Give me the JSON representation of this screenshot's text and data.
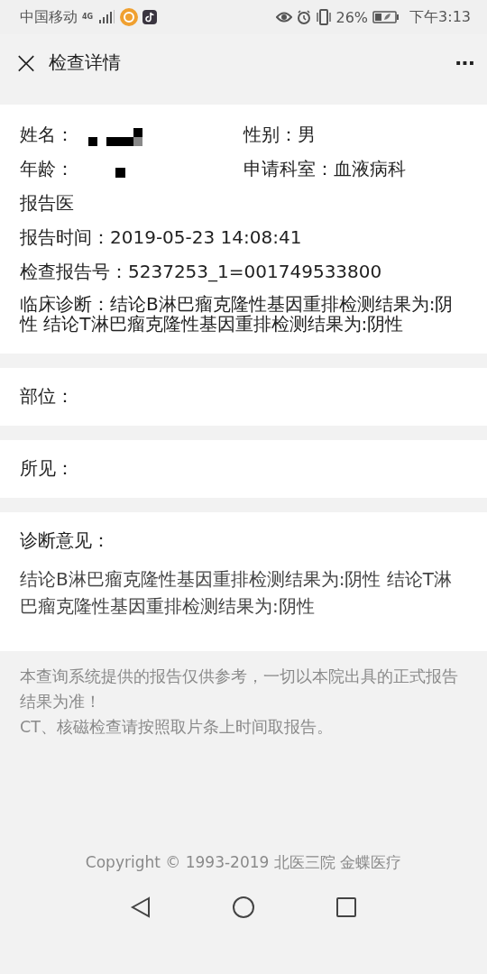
{
  "status_bar": {
    "carrier": "中国移动",
    "network": "4G",
    "battery": "26%",
    "time": "下午3:13"
  },
  "header": {
    "title": "检查详情",
    "close": "×",
    "more": "···"
  },
  "patient": {
    "fields": [
      {
        "label": "姓名：",
        "kind": "redacted"
      },
      {
        "label": "性别：",
        "value": "男",
        "kind": "text"
      },
      {
        "label": "年龄：",
        "kind": "redacted"
      },
      {
        "label": "申请科室：",
        "value": "血液病科",
        "kind": "text"
      },
      {
        "label": "报告医",
        "kind": "text"
      },
      {
        "label": "报告时间：",
        "value": "2019-05-23 14:08:41",
        "kind": "text"
      },
      {
        "label": "检查报告号：",
        "value": "5237253_1=001749533800",
        "kind": "text"
      },
      {
        "label": "临床诊断：",
        "value": "结论B淋巴瘤克隆性基因重排检测结果为:阴性 结论T淋巴瘤克隆性基因重排检测结果为:阴性",
        "kind": "text"
      }
    ]
  },
  "sections": [
    {
      "label": "部位："
    },
    {
      "label": "所见："
    },
    {
      "label": "诊断意见：",
      "body": "结论B淋巴瘤克隆性基因重排检测结果为:阴性 结论T淋巴瘤克隆性基因重排检测结果为:阴性"
    }
  ],
  "notice": [
    "本查询系统提供的报告仅供参考，一切以本院出具的正式报告结果为准！",
    " CT、核磁检查请按照取片条上时间取报告。"
  ],
  "copyright": "Copyright © 1993-2019 北医三院 金蝶医疗"
}
